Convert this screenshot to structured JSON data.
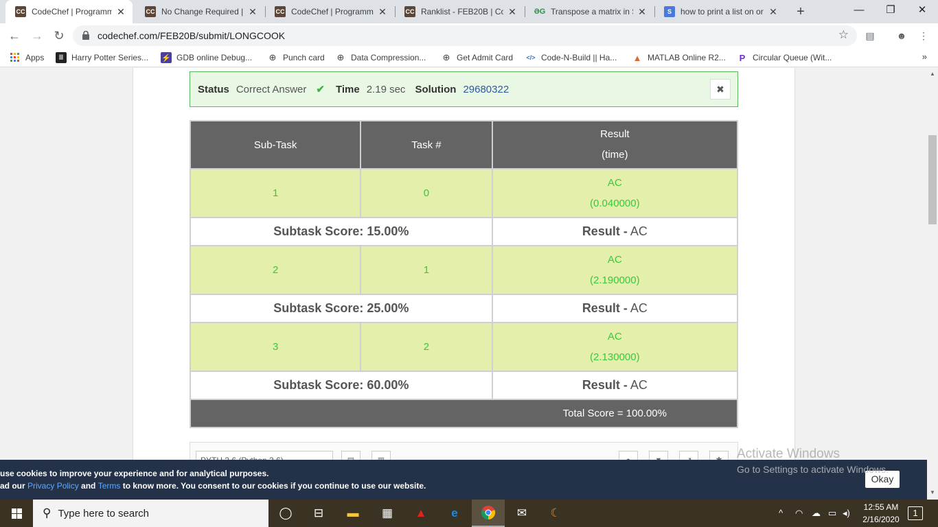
{
  "browser": {
    "tabs": [
      {
        "label": "CodeChef | Programmin",
        "favicon": "CC",
        "close": "✕"
      },
      {
        "label": "No Change Required | C",
        "favicon": "CC",
        "close": "✕"
      },
      {
        "label": "CodeChef | Programmin",
        "favicon": "CC",
        "close": "✕"
      },
      {
        "label": "Ranklist - FEB20B | Code",
        "favicon": "CC",
        "close": "✕"
      },
      {
        "label": "Transpose a matrix in Si",
        "favicon": "ƏG",
        "close": "✕"
      },
      {
        "label": "how to print a list on or",
        "favicon": "S",
        "close": "✕"
      }
    ],
    "new_tab": "+",
    "window_controls": {
      "minimize": "—",
      "maximize": "❐",
      "close": "✕"
    },
    "url": "codechef.com/FEB20B/submit/LONGCOOK",
    "bookmarks": [
      {
        "label": "Apps",
        "icon": "apps-grid-icon"
      },
      {
        "label": "Harry Potter Series...",
        "icon": "library-icon"
      },
      {
        "label": "GDB online Debug...",
        "icon": "bolt-icon"
      },
      {
        "label": "Punch card",
        "icon": "globe-icon"
      },
      {
        "label": "Data Compression...",
        "icon": "globe-icon"
      },
      {
        "label": "Get Admit Card",
        "icon": "globe-icon"
      },
      {
        "label": "Code-N-Build || Ha...",
        "icon": "code-icon"
      },
      {
        "label": "MATLAB Online R2...",
        "icon": "matlab-icon"
      },
      {
        "label": "Circular Queue (Wit...",
        "icon": "circular-queue-icon"
      }
    ],
    "bookmarks_more": "»"
  },
  "status_bar": {
    "status_label": "Status",
    "status_value": "Correct Answer",
    "check": "✔",
    "time_label": "Time",
    "time_value": "2.19 sec",
    "solution_label": "Solution",
    "solution_value": "29680322",
    "close": "✖"
  },
  "result_table": {
    "headers": {
      "subtask": "Sub-Task",
      "task": "Task #",
      "result_line1": "Result",
      "result_line2": "(time)"
    },
    "rows": [
      {
        "subtask": "1",
        "task": "0",
        "result": "AC",
        "time": "(0.040000)",
        "score_label": "Subtask Score: 15.00%",
        "result_label": "Result -",
        "result_value": "AC"
      },
      {
        "subtask": "2",
        "task": "1",
        "result": "AC",
        "time": "(2.190000)",
        "score_label": "Subtask Score: 25.00%",
        "result_label": "Result -",
        "result_value": "AC"
      },
      {
        "subtask": "3",
        "task": "2",
        "result": "AC",
        "time": "(2.130000)",
        "score_label": "Subtask Score: 60.00%",
        "result_label": "Result -",
        "result_value": "AC"
      }
    ],
    "total": "Total Score = 100.00%"
  },
  "editor_bar": {
    "language": "PYTH 3.6 (Python 3.6)"
  },
  "cookie_banner": {
    "line1": "use cookies to improve your experience and for analytical purposes.",
    "line2_start": "ad our ",
    "privacy": "Privacy Policy",
    "and": " and ",
    "terms": "Terms",
    "line2_end": " to know more. You consent to our cookies if you continue to use our website.",
    "okay": "Okay"
  },
  "watermark": {
    "line1": "Activate Windows",
    "line2": "Go to Settings to activate Windows."
  },
  "taskbar": {
    "search_placeholder": "Type here to search",
    "time": "12:55 AM",
    "date": "2/16/2020",
    "notifications": "1"
  },
  "colors": {
    "accent_green": "#3cc73c",
    "status_bg": "#e8f8e4",
    "header_gray": "#646464",
    "row_yellow": "#e4efac",
    "cookie_bg": "#243249"
  }
}
